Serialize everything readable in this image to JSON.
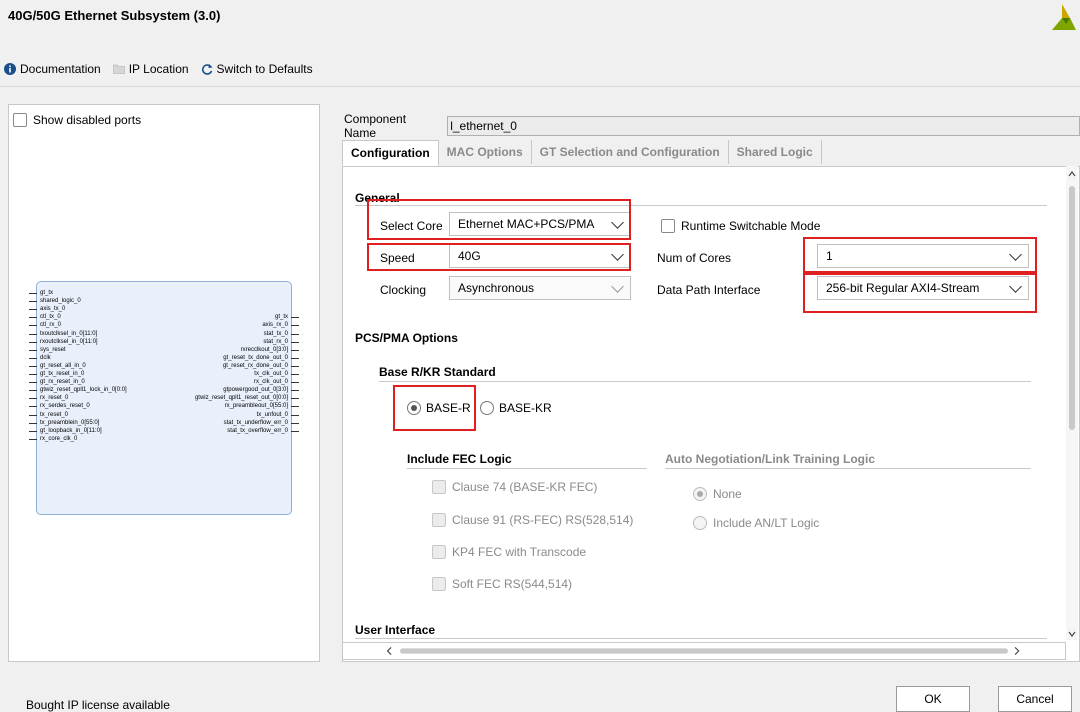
{
  "window": {
    "title": "40G/50G Ethernet Subsystem (3.0)"
  },
  "toolbar": {
    "documentation": "Documentation",
    "ip_location": "IP Location",
    "switch_defaults": "Switch to Defaults"
  },
  "left": {
    "show_disabled": "Show disabled ports",
    "left_ports": [
      "gt_tx",
      "shared_logic_0",
      "axis_tx_0",
      "ctl_tx_0",
      "ctl_rx_0",
      "txoutclksel_in_0[11:0]",
      "rxoutclksel_in_0[11:0]",
      "sys_reset",
      "dclk",
      "gt_reset_all_in_0",
      "gt_tx_reset_in_0",
      "gt_rx_reset_in_0",
      "gtwiz_reset_qpll1_lock_in_0[0:0]",
      "rx_reset_0",
      "rx_serdes_reset_0",
      "tx_reset_0",
      "tx_preamblein_0[55:0]",
      "gt_loopback_in_0[11:0]",
      "rx_core_clk_0"
    ],
    "right_ports": [
      "gt_tx",
      "axis_rx_0",
      "stat_tx_0",
      "stat_rx_0",
      "rxrecclkout_0[3:0]",
      "gt_reset_tx_done_out_0",
      "gt_reset_rx_done_out_0",
      "tx_clk_out_0",
      "rx_clk_out_0",
      "gtpowergood_out_0[3:0]",
      "gtwiz_reset_qpll1_reset_out_0[0:0]",
      "rx_preambleout_0[55:0]",
      "tx_unfout_0",
      "stat_tx_underflow_err_0",
      "stat_tx_overflow_err_0"
    ]
  },
  "component": {
    "label": "Component Name",
    "value": "l_ethernet_0"
  },
  "tabs": [
    "Configuration",
    "MAC Options",
    "GT Selection and Configuration",
    "Shared Logic"
  ],
  "general": {
    "heading": "General",
    "select_core_label": "Select Core",
    "select_core_value": "Ethernet MAC+PCS/PMA",
    "runtime_switchable": "Runtime Switchable Mode",
    "speed_label": "Speed",
    "speed_value": "40G",
    "num_cores_label": "Num of Cores",
    "num_cores_value": "1",
    "clocking_label": "Clocking",
    "clocking_value": "Asynchronous",
    "dpi_label": "Data Path Interface",
    "dpi_value": "256-bit Regular AXI4-Stream"
  },
  "pcs": {
    "heading": "PCS/PMA Options",
    "std_heading": "Base R/KR Standard",
    "base_r": "BASE-R",
    "base_kr": "BASE-KR",
    "fec_heading": "Include FEC Logic",
    "fec_options": [
      "Clause 74 (BASE-KR FEC)",
      "Clause 91 (RS-FEC) RS(528,514)",
      "KP4 FEC with Transcode",
      "Soft FEC RS(544,514)"
    ],
    "an_heading": "Auto Negotiation/Link Training Logic",
    "an_none": "None",
    "an_include": "Include AN/LT Logic"
  },
  "user_interface": "User Interface",
  "footer": {
    "license": "Bought IP license available",
    "ok": "OK",
    "cancel": "Cancel"
  }
}
